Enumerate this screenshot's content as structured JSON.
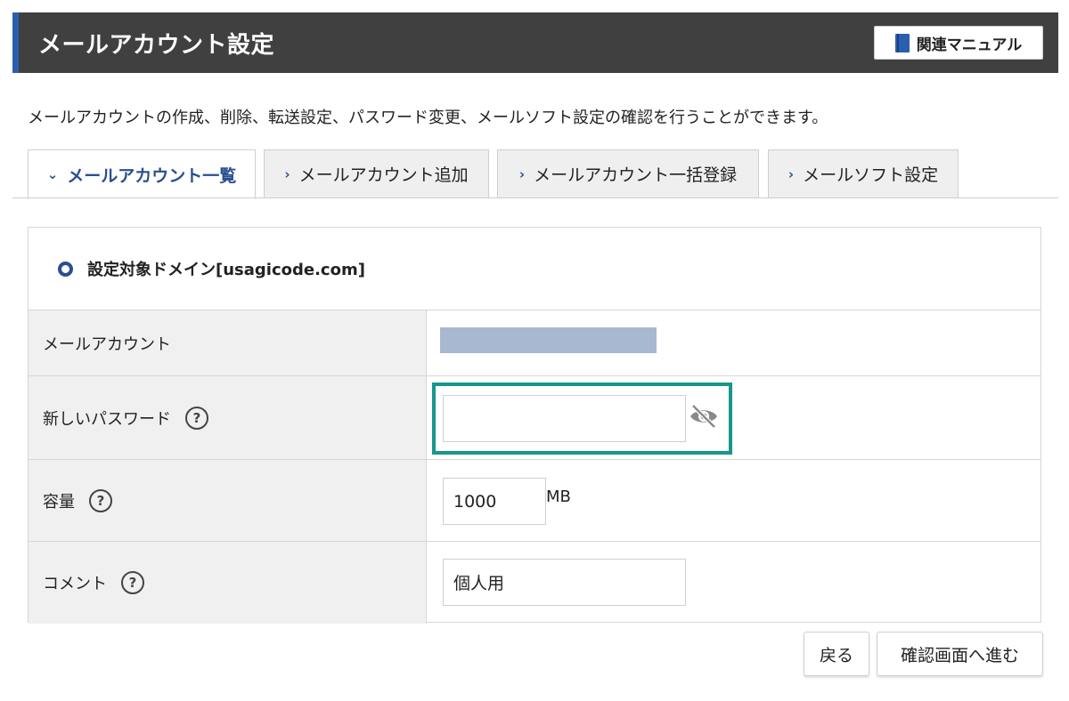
{
  "header": {
    "title": "メールアカウント設定",
    "manual_button": "関連マニュアル"
  },
  "description": "メールアカウントの作成、削除、転送設定、パスワード変更、メールソフト設定の確認を行うことができます。",
  "tabs": [
    {
      "label": "メールアカウント一覧",
      "active": true
    },
    {
      "label": "メールアカウント追加",
      "active": false
    },
    {
      "label": "メールアカウント一括登録",
      "active": false
    },
    {
      "label": "メールソフト設定",
      "active": false
    }
  ],
  "form": {
    "domain_title": "設定対象ドメイン[usagicode.com]",
    "rows": {
      "account": {
        "label": "メールアカウント"
      },
      "password": {
        "label": "新しいパスワード",
        "value": ""
      },
      "capacity": {
        "label": "容量",
        "value": "1000",
        "unit": "MB"
      },
      "comment": {
        "label": "コメント",
        "value": "個人用"
      }
    },
    "help_glyph": "?"
  },
  "buttons": {
    "back": "戻る",
    "confirm": "確認画面へ進む"
  },
  "colors": {
    "header_bg": "#404040",
    "accent": "#2a5fb0",
    "highlight": "#18968c",
    "tab_active_text": "#2a4f8f"
  }
}
